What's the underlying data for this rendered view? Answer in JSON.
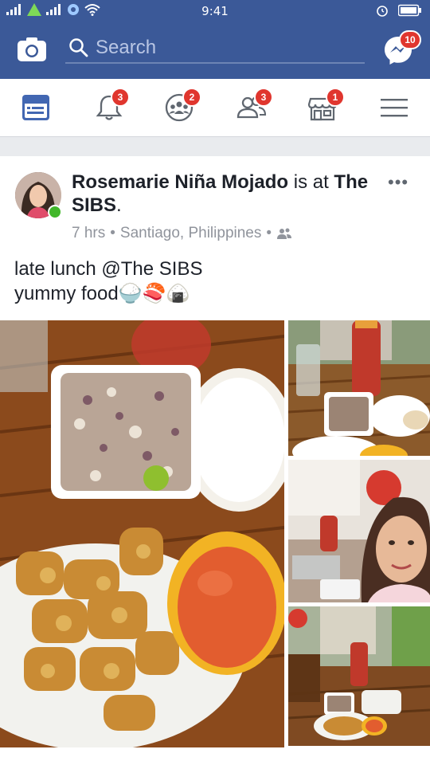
{
  "status_bar": {
    "time": "9:41",
    "icons": [
      "signal-icon",
      "data-icon",
      "signal-icon",
      "settings-icon",
      "wifi-icon",
      "alarm-icon",
      "battery-icon"
    ]
  },
  "top_bar": {
    "search_placeholder": "Search",
    "camera_icon": "camera-icon",
    "messenger_icon": "messenger-icon",
    "messenger_badge": "10",
    "brand_color": "#3b5998"
  },
  "nav": {
    "items": [
      {
        "name": "news-feed",
        "icon": "news-feed-icon",
        "badge": ""
      },
      {
        "name": "notifications",
        "icon": "bell-icon",
        "badge": "3"
      },
      {
        "name": "groups",
        "icon": "groups-icon",
        "badge": "2"
      },
      {
        "name": "friend-requests",
        "icon": "friends-icon",
        "badge": "3"
      },
      {
        "name": "marketplace",
        "icon": "store-icon",
        "badge": "1"
      },
      {
        "name": "menu",
        "icon": "hamburger-icon",
        "badge": ""
      }
    ]
  },
  "post": {
    "author": "Rosemarie Niña Mojado",
    "is_at": "is at",
    "place": "The SIBS",
    "place_suffix": ".",
    "time": "7 hrs",
    "location": "Santiago, Philippines",
    "separator": "•",
    "caption_line1_prefix": "late lunch ",
    "caption_line1_mention": "@The SIBS",
    "caption_line2": "yummy food🍚🍣🍙",
    "photos": [
      "food-platter-photo",
      "table-overview-photo",
      "selfie-photo",
      "restaurant-table-photo"
    ]
  }
}
